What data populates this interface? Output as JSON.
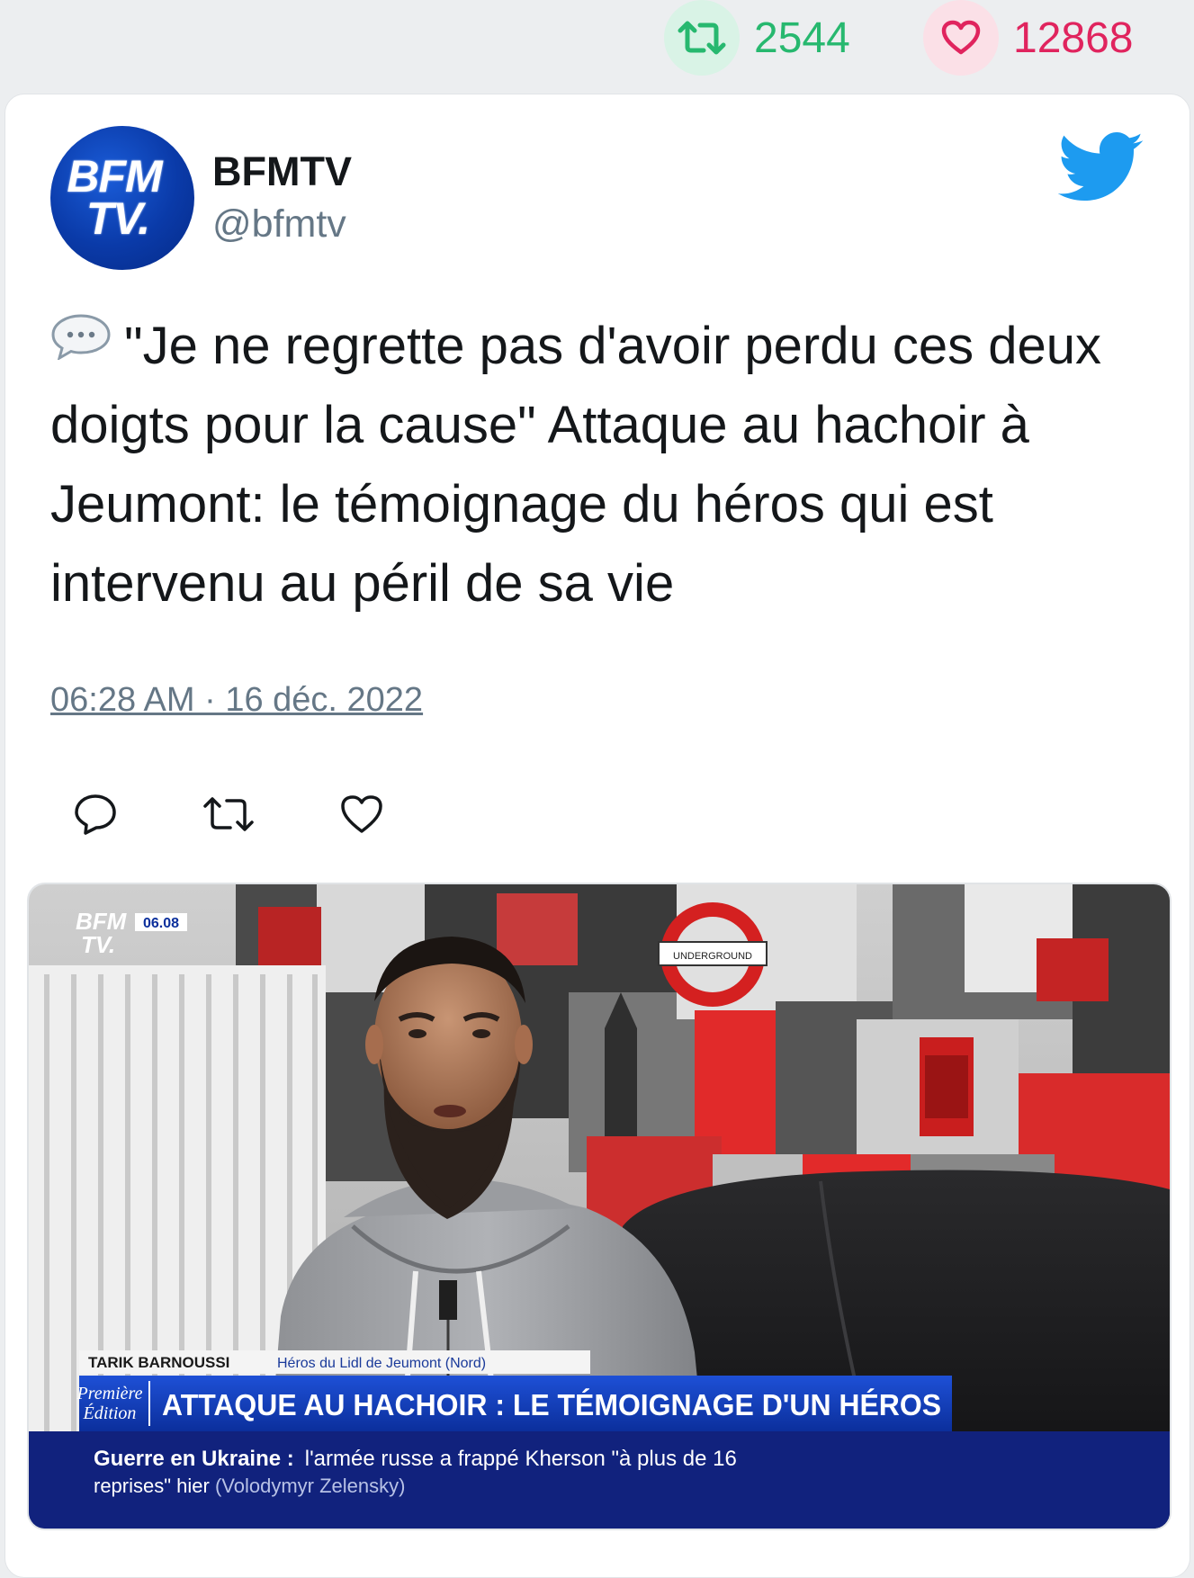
{
  "stats": {
    "retweets": "2544",
    "likes": "12868",
    "retweet_color": "#27b86f",
    "like_color": "#e0245e"
  },
  "tweet": {
    "author_name": "BFMTV",
    "author_handle": "@bfmtv",
    "avatar_text_line1": "BFM",
    "avatar_text_line2": "TV.",
    "text": "\"Je ne regrette pas d'avoir perdu ces deux doigts pour la cause\" Attaque au hachoir à Jeumont: le témoignage du héros qui est intervenu au péril de sa vie",
    "leading_icon": "speech-bubble-icon",
    "timestamp": "06:28 AM · 16 déc. 2022"
  },
  "actions": [
    "reply-icon",
    "retweet-icon",
    "like-icon"
  ],
  "media": {
    "logo_line1": "BFM",
    "logo_line2": "TV.",
    "clock": "06.08",
    "sign_text": "UNDERGROUND",
    "person_name": "TARIK BARNOUSSI",
    "person_caption": "Héros du Lidl de Jeumont (Nord)",
    "show_line1": "Première",
    "show_line2": "Édition",
    "headline": "ATTAQUE AU HACHOIR : LE TÉMOIGNAGE D'UN HÉROS",
    "ticker_bold": "Guerre en Ukraine :",
    "ticker_text": "l'armée russe a frappé Kherson \"à plus de 16 reprises\" hier",
    "ticker_source": "(Volodymyr Zelensky)"
  },
  "colors": {
    "twitter_blue": "#1d9bf0",
    "text": "#14171a",
    "muted": "#657786",
    "bfm_blue": "#0a3aa8"
  }
}
